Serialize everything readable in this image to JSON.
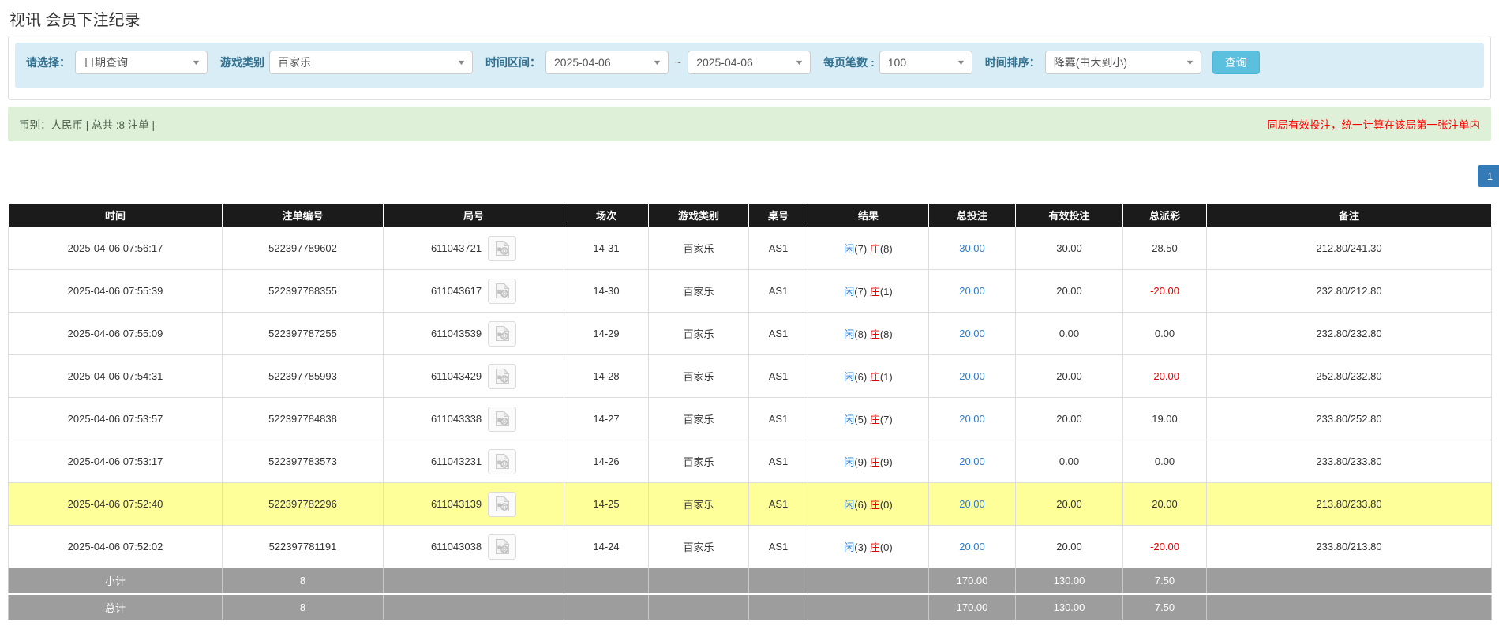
{
  "title": "视讯 会员下注纪录",
  "filters": {
    "select_label": "请选择：",
    "select_value": "日期查询",
    "game_label": "游戏类别",
    "game_value": "百家乐",
    "range_label": "时间区间：",
    "date_from": "2025-04-06",
    "range_separator": "~",
    "date_to": "2025-04-06",
    "page_size_label": "每页笔数 :",
    "page_size_value": "100",
    "sort_label": "时间排序：",
    "sort_value": "降冪(由大到小)",
    "query_button": "查询"
  },
  "summary": {
    "left": "币别：人民币 | 总共 :8 注单 |",
    "notice": "同局有效投注，统一计算在该局第一张注单内"
  },
  "pagination": {
    "current_page": "1"
  },
  "table": {
    "columns": [
      "时间",
      "注单编号",
      "局号",
      "场次",
      "游戏类别",
      "桌号",
      "结果",
      "总投注",
      "有效投注",
      "总派彩",
      "备注"
    ],
    "rows": [
      {
        "time": "2025-04-06 07:56:17",
        "bet_id": "522397789602",
        "round_id": "611043721",
        "session": "14-31",
        "game": "百家乐",
        "table_id": "AS1",
        "result": {
          "player": "闲",
          "player_n": "(7)",
          "banker": "庄",
          "banker_n": "(8)"
        },
        "total_bet": "30.00",
        "valid_bet": "30.00",
        "payout": "28.50",
        "remark": "212.80/241.30",
        "highlighted": false
      },
      {
        "time": "2025-04-06 07:55:39",
        "bet_id": "522397788355",
        "round_id": "611043617",
        "session": "14-30",
        "game": "百家乐",
        "table_id": "AS1",
        "result": {
          "player": "闲",
          "player_n": "(7)",
          "banker": "庄",
          "banker_n": "(1)"
        },
        "total_bet": "20.00",
        "valid_bet": "20.00",
        "payout": "-20.00",
        "remark": "232.80/212.80",
        "highlighted": false
      },
      {
        "time": "2025-04-06 07:55:09",
        "bet_id": "522397787255",
        "round_id": "611043539",
        "session": "14-29",
        "game": "百家乐",
        "table_id": "AS1",
        "result": {
          "player": "闲",
          "player_n": "(8)",
          "banker": "庄",
          "banker_n": "(8)"
        },
        "total_bet": "20.00",
        "valid_bet": "0.00",
        "payout": "0.00",
        "remark": "232.80/232.80",
        "highlighted": false
      },
      {
        "time": "2025-04-06 07:54:31",
        "bet_id": "522397785993",
        "round_id": "611043429",
        "session": "14-28",
        "game": "百家乐",
        "table_id": "AS1",
        "result": {
          "player": "闲",
          "player_n": "(6)",
          "banker": "庄",
          "banker_n": "(1)"
        },
        "total_bet": "20.00",
        "valid_bet": "20.00",
        "payout": "-20.00",
        "remark": "252.80/232.80",
        "highlighted": false
      },
      {
        "time": "2025-04-06 07:53:57",
        "bet_id": "522397784838",
        "round_id": "611043338",
        "session": "14-27",
        "game": "百家乐",
        "table_id": "AS1",
        "result": {
          "player": "闲",
          "player_n": "(5)",
          "banker": "庄",
          "banker_n": "(7)"
        },
        "total_bet": "20.00",
        "valid_bet": "20.00",
        "payout": "19.00",
        "remark": "233.80/252.80",
        "highlighted": false
      },
      {
        "time": "2025-04-06 07:53:17",
        "bet_id": "522397783573",
        "round_id": "611043231",
        "session": "14-26",
        "game": "百家乐",
        "table_id": "AS1",
        "result": {
          "player": "闲",
          "player_n": "(9)",
          "banker": "庄",
          "banker_n": "(9)"
        },
        "total_bet": "20.00",
        "valid_bet": "0.00",
        "payout": "0.00",
        "remark": "233.80/233.80",
        "highlighted": false
      },
      {
        "time": "2025-04-06 07:52:40",
        "bet_id": "522397782296",
        "round_id": "611043139",
        "session": "14-25",
        "game": "百家乐",
        "table_id": "AS1",
        "result": {
          "player": "闲",
          "player_n": "(6)",
          "banker": "庄",
          "banker_n": "(0)"
        },
        "total_bet": "20.00",
        "valid_bet": "20.00",
        "payout": "20.00",
        "remark": "213.80/233.80",
        "highlighted": true
      },
      {
        "time": "2025-04-06 07:52:02",
        "bet_id": "522397781191",
        "round_id": "611043038",
        "session": "14-24",
        "game": "百家乐",
        "table_id": "AS1",
        "result": {
          "player": "闲",
          "player_n": "(3)",
          "banker": "庄",
          "banker_n": "(0)"
        },
        "total_bet": "20.00",
        "valid_bet": "20.00",
        "payout": "-20.00",
        "remark": "233.80/213.80",
        "highlighted": false
      }
    ],
    "footer": [
      {
        "label": "小计",
        "count": "8",
        "total_bet": "170.00",
        "valid_bet": "130.00",
        "payout": "7.50"
      },
      {
        "label": "总计",
        "count": "8",
        "total_bet": "170.00",
        "valid_bet": "130.00",
        "payout": "7.50"
      }
    ]
  },
  "colors": {
    "filter_bar_bg": "#d9edf7",
    "filter_label": "#31708f",
    "query_button_bg": "#5bc0de",
    "summary_bg": "#dff0d8",
    "summary_text": "#4b614b",
    "notice_red": "#ff0000",
    "header_bg": "#1b1b1b",
    "footer_bg": "#9d9d9d",
    "highlight_yellow": "#ffff99",
    "link_blue": "#2e7bcc",
    "banker_red": "#e60000",
    "negative_red": "#e60000",
    "page_button_bg": "#337ab7"
  }
}
